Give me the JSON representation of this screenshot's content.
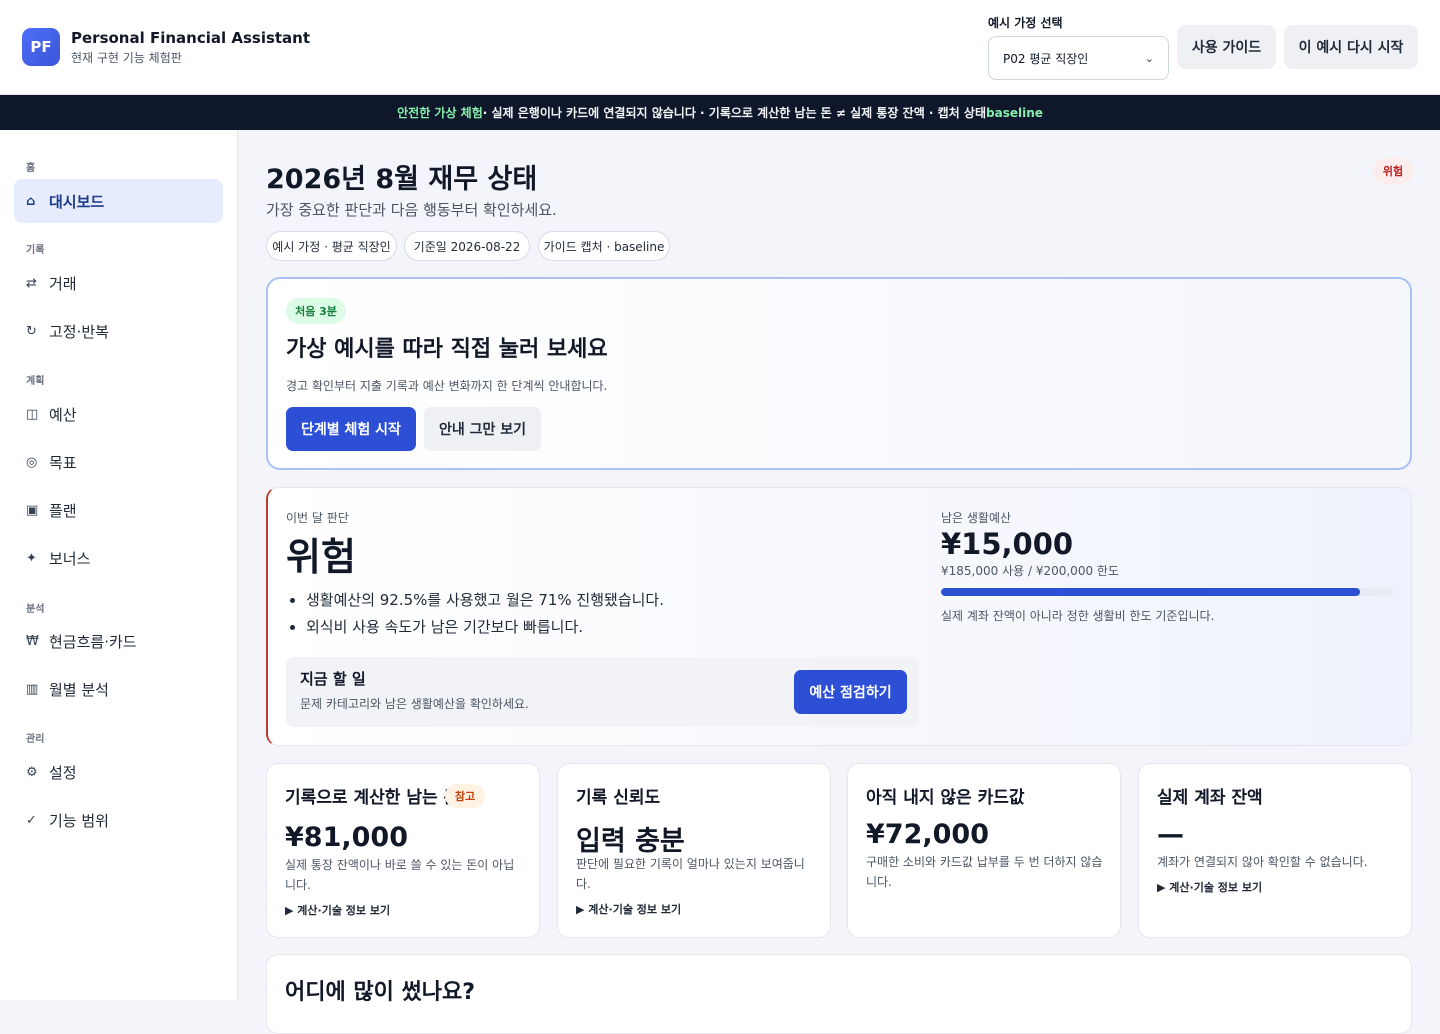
{
  "header": {
    "logo": "PF",
    "title": "Personal Financial Assistant",
    "subtitle": "현재 구현 기능 체험판",
    "scenario_label": "예시 가정 선택",
    "scenario_value": "P02 평균 직장인",
    "guide_button": "사용 가이드",
    "restart_button": "이 예시 다시 시작"
  },
  "notice": {
    "highlight": "안전한 가상 체험",
    "text": " · 실제 은행이나 카드에 연결되지 않습니다 · 기록으로 계산한 남는 돈 ≠ 실제 통장 잔액 · 캡처 상태 ",
    "state": "baseline"
  },
  "sidebar": {
    "sections": [
      {
        "label": "홈",
        "items": [
          {
            "icon": "home-icon",
            "glyph": "⌂",
            "label": "대시보드",
            "active": true
          }
        ]
      },
      {
        "label": "기록",
        "items": [
          {
            "icon": "swap-icon",
            "glyph": "⇄",
            "label": "거래",
            "active": false
          },
          {
            "icon": "repeat-icon",
            "glyph": "↻",
            "label": "고정·반복",
            "active": false
          }
        ]
      },
      {
        "label": "계획",
        "items": [
          {
            "icon": "budget-icon",
            "glyph": "◫",
            "label": "예산",
            "active": false
          },
          {
            "icon": "target-icon",
            "glyph": "◎",
            "label": "목표",
            "active": false
          },
          {
            "icon": "plan-icon",
            "glyph": "▣",
            "label": "플랜",
            "active": false
          },
          {
            "icon": "sparkle-icon",
            "glyph": "✦",
            "label": "보너스",
            "active": false
          }
        ]
      },
      {
        "label": "분석",
        "items": [
          {
            "icon": "won-icon",
            "glyph": "₩",
            "label": "현금흐름·카드",
            "active": false
          },
          {
            "icon": "chart-icon",
            "glyph": "▥",
            "label": "월별 분석",
            "active": false
          }
        ]
      },
      {
        "label": "관리",
        "items": [
          {
            "icon": "gear-icon",
            "glyph": "⚙",
            "label": "설정",
            "active": false
          },
          {
            "icon": "check-icon",
            "glyph": "✓",
            "label": "기능 범위",
            "active": false
          }
        ]
      }
    ]
  },
  "main": {
    "title": "2026년 8월 재무 상태",
    "subtitle": "가장 중요한 판단과 다음 행동부터 확인하세요.",
    "status_badge": "위험",
    "chips": [
      "예시 가정 · 평균 직장인",
      "기준일 2026-08-22",
      "가이드 캡처 · baseline"
    ],
    "onboarding": {
      "tag": "처음 3분",
      "title": "가상 예시를 따라 직접 눌러 보세요",
      "description": "경고 확인부터 지출 기록과 예산 변화까지 한 단계씩 안내합니다.",
      "start_button": "단계별 체험 시작",
      "dismiss_button": "안내 그만 보기"
    },
    "verdict": {
      "label": "이번 달 판단",
      "title": "위험",
      "bullets": [
        "생활예산의 92.5%를 사용했고 월은 71% 진행됐습니다.",
        "외식비 사용 속도가 남은 기간보다 빠릅니다."
      ],
      "todo_title": "지금 할 일",
      "todo_desc": "문제 카테고리와 남은 생활예산을 확인하세요.",
      "todo_button": "예산 점검하기",
      "remaining_label": "남은 생활예산",
      "remaining_amount": "¥15,000",
      "usage": "¥185,000 사용 / ¥200,000 한도",
      "usage_fraction": 0.925,
      "note": "실제 계좌 잔액이 아니라 정한 생활비 한도 기준입니다."
    },
    "cards": [
      {
        "title": "기록으로 계산한 남는 돈",
        "badge": "참고",
        "value": "¥81,000",
        "desc": "실제 통장 잔액이나 바로 쓸 수 있는 돈이 아닙니다.",
        "more": "▶ 계산·기술 정보 보기"
      },
      {
        "title": "기록 신뢰도",
        "badge": "",
        "value": "입력 충분",
        "desc": "판단에 필요한 기록이 얼마나 있는지 보여줍니다.",
        "more": "▶ 계산·기술 정보 보기"
      },
      {
        "title": "아직 내지 않은 카드값",
        "badge": "",
        "value": "¥72,000",
        "desc": "구매한 소비와 카드값 납부를 두 번 더하지 않습니다.",
        "more": ""
      },
      {
        "title": "실제 계좌 잔액",
        "badge": "",
        "value": "—",
        "desc": "계좌가 연결되지 않아 확인할 수 없습니다.",
        "more": "▶ 계산·기술 정보 보기"
      }
    ],
    "bottom_title": "어디에 많이 썼나요?"
  }
}
